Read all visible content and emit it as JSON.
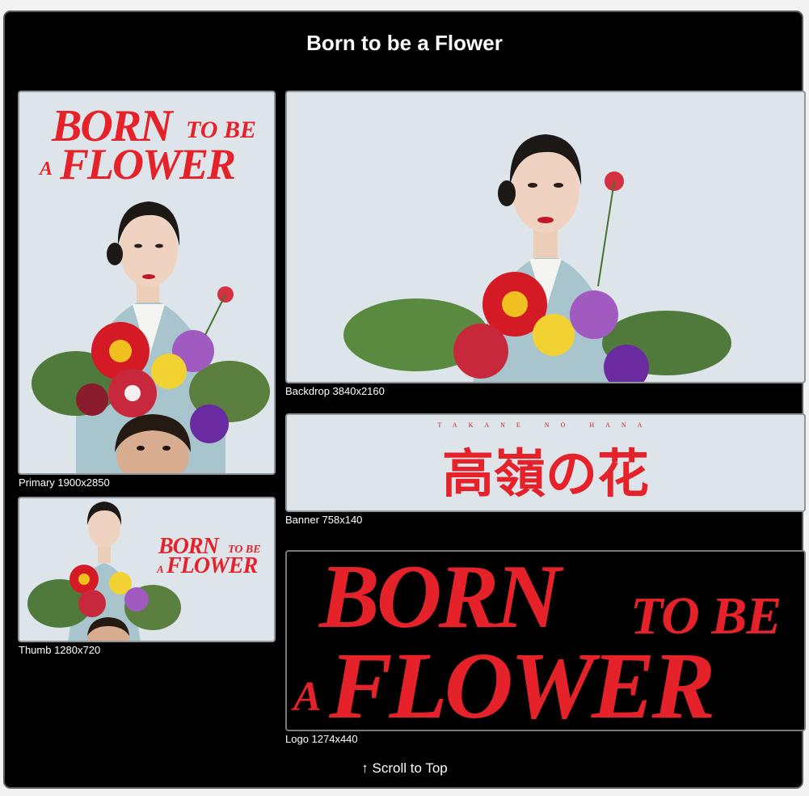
{
  "page_title": "Born to be a Flower",
  "poster_text": {
    "born": "BORN",
    "to_be": "TO BE",
    "a": "A",
    "flower": "FLOWER"
  },
  "banner_text": {
    "romaji": "TAKANE NO HANA",
    "kanji": "高嶺の花"
  },
  "images": [
    {
      "caption": "Primary 1900x2850"
    },
    {
      "caption": "Backdrop 3840x2160"
    },
    {
      "caption": "Banner 758x140"
    },
    {
      "caption": "Thumb 1280x720"
    },
    {
      "caption": "Logo 1274x440"
    }
  ],
  "scroll_label": "↑ Scroll to Top",
  "colors": {
    "accent_red": "#e5222a",
    "background": "#000000",
    "card": "#dde4ea"
  }
}
